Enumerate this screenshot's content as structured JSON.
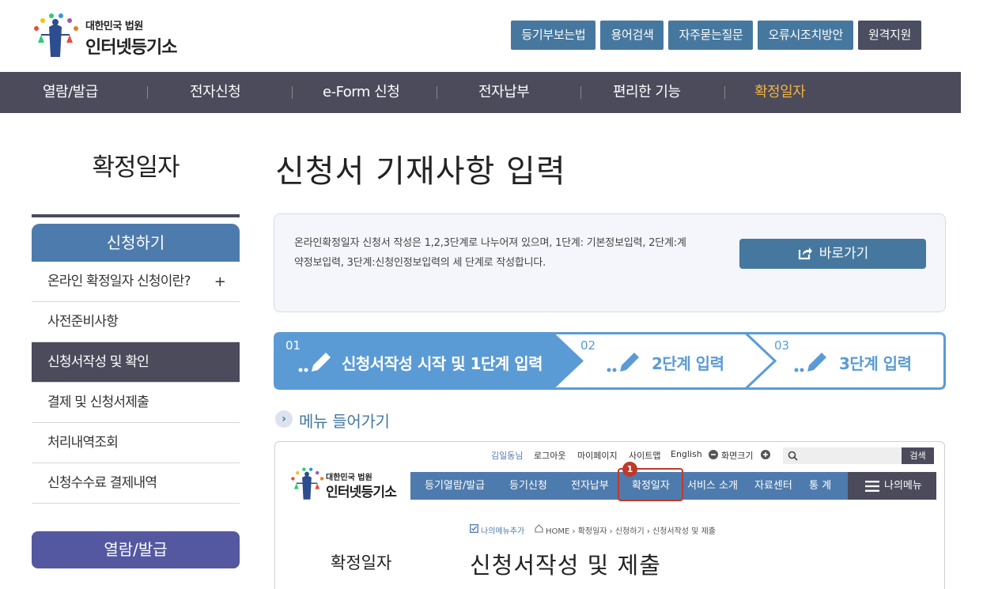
{
  "header": {
    "logo_small": "대한민국 법원",
    "logo_big": "인터넷등기소",
    "buttons": [
      "등기부보는법",
      "용어검색",
      "자주묻는질문",
      "오류시조치방안",
      "원격지원"
    ]
  },
  "gnb": {
    "items": [
      "열람/발급",
      "전자신청",
      "e-Form 신청",
      "전자납부",
      "편리한 기능",
      "확정일자"
    ],
    "active_color": "#f2b341"
  },
  "sidebar": {
    "title": "확정일자",
    "section_label": "신청하기",
    "items": [
      {
        "label": "온라인 확정일자 신청이란?",
        "plus": "+"
      },
      {
        "label": "사전준비사항"
      },
      {
        "label": "신청서작성 및 확인"
      },
      {
        "label": "결제 및 신청서제출"
      },
      {
        "label": "처리내역조회"
      },
      {
        "label": "신청수수료 결제내역"
      }
    ],
    "section2_label": "열람/발급"
  },
  "main": {
    "title": "신청서 기재사항 입력",
    "info_text": "온라인확정일자 신청서 작성은 1,2,3단계로 나누어져 있으며, 1단계: 기본정보입력, 2단계:계약정보입력, 3단계:신청인정보입력의 세 단계로 작성합니다.",
    "go_button": "바로가기",
    "steps": [
      {
        "num": "01",
        "label": "신청서작성 시작 및 1단계 입력"
      },
      {
        "num": "02",
        "label": "2단계 입력"
      },
      {
        "num": "03",
        "label": "3단계 입력"
      }
    ],
    "sub_heading": "메뉴 들어가기"
  },
  "preview": {
    "util_links": [
      "김일동님",
      "로그아웃",
      "마이페이지",
      "사이트맵",
      "English",
      "화면크기"
    ],
    "search_button": "검색",
    "logo_small": "대한민국 법원",
    "logo_big": "인터넷등기소",
    "nav_items": [
      "등기열람/발급",
      "등기신청",
      "전자납부",
      "확정일자",
      "서비스 소개",
      "자료센터",
      "통 계"
    ],
    "my_menu": "나의메뉴",
    "badge": "1",
    "crumb_add": "나의메뉴추가",
    "breadcrumb": "HOME › 확정일자 › 신청하기 › 신청서작성 및 제출",
    "side_title": "확정일자",
    "page_title": "신청서작성 및 제출"
  },
  "colors": {
    "primary_blue": "#46789f",
    "dark_nav": "#4b4b5c",
    "step_blue": "#5b9bd5",
    "highlight_red": "#c0392b"
  }
}
